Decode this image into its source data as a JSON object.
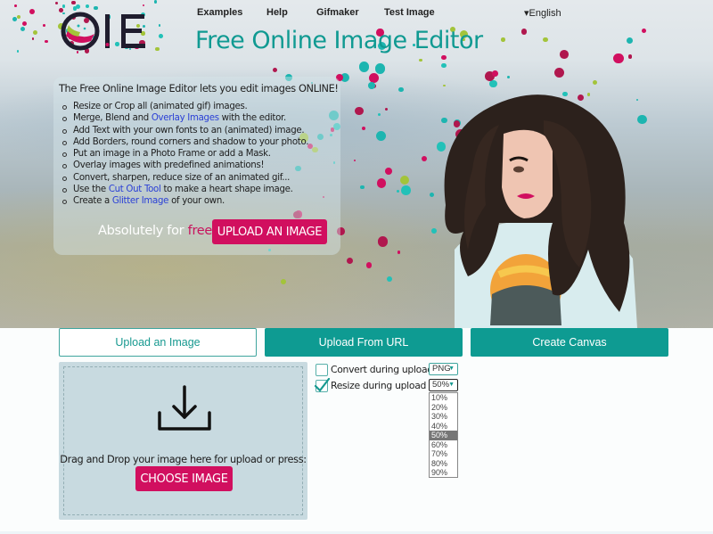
{
  "header": {
    "logo_text": "OIE",
    "nav": [
      {
        "label": "Examples"
      },
      {
        "label": "Help"
      },
      {
        "label": "Gifmaker"
      },
      {
        "label": "Test Image"
      }
    ],
    "language": "▾English",
    "title": "Free Online Image Editor"
  },
  "hero": {
    "intro": "The Free Online Image Editor lets you edit images ONLINE!",
    "features": [
      {
        "before": "Resize or Crop all (animated gif) images.",
        "link": "",
        "after": ""
      },
      {
        "before": "Merge, Blend and ",
        "link": "Overlay Images",
        "after": " with the editor."
      },
      {
        "before": "Add Text with your own fonts to an (animated) image.",
        "link": "",
        "after": ""
      },
      {
        "before": "Add Borders, round corners and shadow to your photo.",
        "link": "",
        "after": ""
      },
      {
        "before": "Put an image in a Photo Frame or add a Mask.",
        "link": "",
        "after": ""
      },
      {
        "before": "Overlay images with predefined animations!",
        "link": "",
        "after": ""
      },
      {
        "before": "Convert, sharpen, reduce size of an animated gif...",
        "link": "",
        "after": ""
      },
      {
        "before": "Use the ",
        "link": "Cut Out Tool",
        "after": " to make a heart shape image."
      },
      {
        "before": "Create a ",
        "link": "Glitter Image",
        "after": " of your own."
      }
    ],
    "free_prefix": "Absolutely for ",
    "free_word": "free",
    "upload_button": "UPLOAD AN IMAGE"
  },
  "tabs": [
    {
      "label": "Upload an Image",
      "active": true
    },
    {
      "label": "Upload From URL",
      "active": false
    },
    {
      "label": "Create Canvas",
      "active": false
    }
  ],
  "dropzone": {
    "text": "Drag and Drop your image here for upload or press:",
    "button": "CHOOSE IMAGE"
  },
  "options": {
    "convert": {
      "label": "Convert during upload",
      "checked": false,
      "format": "PNG"
    },
    "resize": {
      "label": "Resize during upload",
      "checked": true,
      "value": "50%"
    },
    "resize_options": [
      "10%",
      "20%",
      "30%",
      "40%",
      "50%",
      "60%",
      "70%",
      "80%",
      "90%"
    ],
    "resize_selected_index": 4
  },
  "colors": {
    "accent_teal": "#0e9b92",
    "accent_pink": "#d10f5f",
    "link_blue": "#2a3fd6",
    "title_teal": "#109a92"
  }
}
